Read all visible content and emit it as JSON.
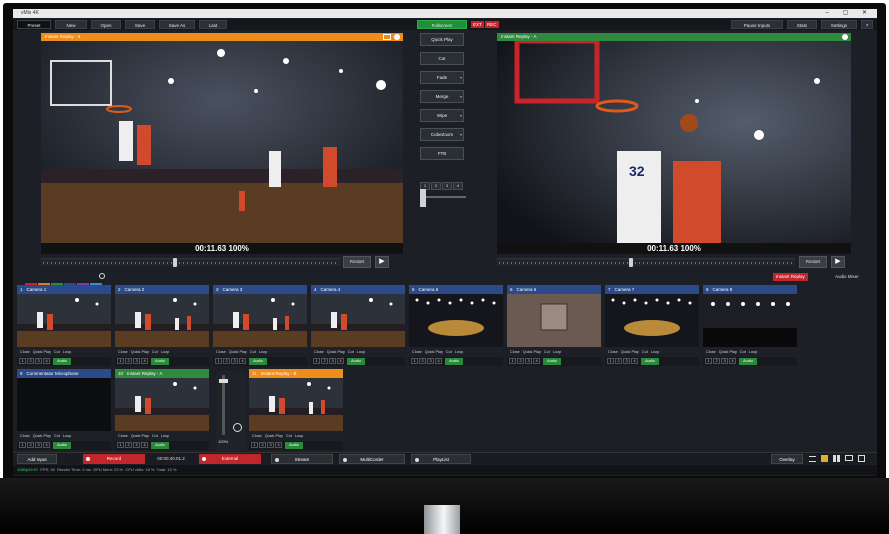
{
  "titlebar": {
    "title": "vMix 4K",
    "window_controls": "– ▢ ✕"
  },
  "menu": {
    "left": [
      "Preset",
      "New",
      "Open",
      "Save",
      "Save As",
      "Last"
    ],
    "fullscreen": "Fullscreen",
    "ext": "EXT",
    "rec": "REC",
    "right": [
      "Pause Inputs",
      "Stats",
      "Settings",
      "?"
    ]
  },
  "preview": {
    "title": "Instant Replay - 0",
    "timecode": "00:11.63  100%",
    "restart": "Restart",
    "play": "▶"
  },
  "output": {
    "title": "Instant Replay - A",
    "timecode": "00:11.63  100%",
    "restart": "Restart",
    "play": "▶"
  },
  "transitions": [
    {
      "label": "Quick Play",
      "dd": ""
    },
    {
      "label": "Cut",
      "dd": ""
    },
    {
      "label": "Fade",
      "dd": "▾"
    },
    {
      "label": "Merge",
      "dd": "▾"
    },
    {
      "label": "Wipe",
      "dd": "▾"
    },
    {
      "label": "CubeZoom",
      "dd": "▾"
    },
    {
      "label": "FTB",
      "dd": ""
    }
  ],
  "transition_numbers": [
    "1",
    "2",
    "3",
    "4"
  ],
  "colors": {
    "accent_orange": "#f08c1a",
    "accent_green": "#2f8a3d",
    "input_blue": "#2a4a8a",
    "fullscreen_green": "#1f8f3a",
    "record_red": "#c0262c"
  },
  "swatches": [
    "#c0262c",
    "#e07b1a",
    "#2f8a3d",
    "#2a4a8a",
    "#7a3aa8",
    "#3a8ad8"
  ],
  "tabs_right": {
    "instant_replay": "Instant Replay",
    "audio_mixer": "Audio Mixer"
  },
  "tile_controls": [
    "Close",
    "Quick Play",
    "Cut",
    "Loop"
  ],
  "tile_numbers": [
    "1",
    "2",
    "3",
    "4"
  ],
  "tile_audio": "Audio",
  "inputs_row1": [
    {
      "num": "1",
      "name": "Camera 1",
      "scene": "court"
    },
    {
      "num": "2",
      "name": "Camera 2",
      "scene": "wide"
    },
    {
      "num": "3",
      "name": "Camera 3",
      "scene": "wide"
    },
    {
      "num": "4",
      "name": "Camera 4",
      "scene": "court"
    },
    {
      "num": "5",
      "name": "Camera 5",
      "scene": "arena"
    },
    {
      "num": "6",
      "name": "Camera 6",
      "scene": "cube"
    },
    {
      "num": "7",
      "name": "Camera 7",
      "scene": "arena"
    },
    {
      "num": "8",
      "name": "Camera 8",
      "scene": "crowd"
    }
  ],
  "inputs_row2": [
    {
      "num": "9",
      "name": "Commentator Microphone",
      "scene": "black",
      "color": "blue"
    },
    {
      "num": "10",
      "name": "Instant Replay - A",
      "scene": "court",
      "color": "green"
    },
    {
      "num": "11",
      "name": "Instant Replay - B",
      "scene": "wide",
      "color": "orange"
    }
  ],
  "fader": {
    "level_label": "100%"
  },
  "bottombar": {
    "add_input": "Add Input",
    "record": "Record",
    "record_time": "00:00:40.01.2",
    "external": "External",
    "stream": "Stream",
    "multicorder": "MultiCorder",
    "playlist": "PlayList",
    "overlay": "Overlay"
  },
  "statusbar": {
    "res": "1080p29.97",
    "fps_label": "FPS:",
    "fps": "30",
    "render_time": "Render Time: 2 ms",
    "gpu": "GPU Mem: 23 %",
    "cpu": "CPU vMix: 18 %",
    "total": "Total: 13 %"
  }
}
